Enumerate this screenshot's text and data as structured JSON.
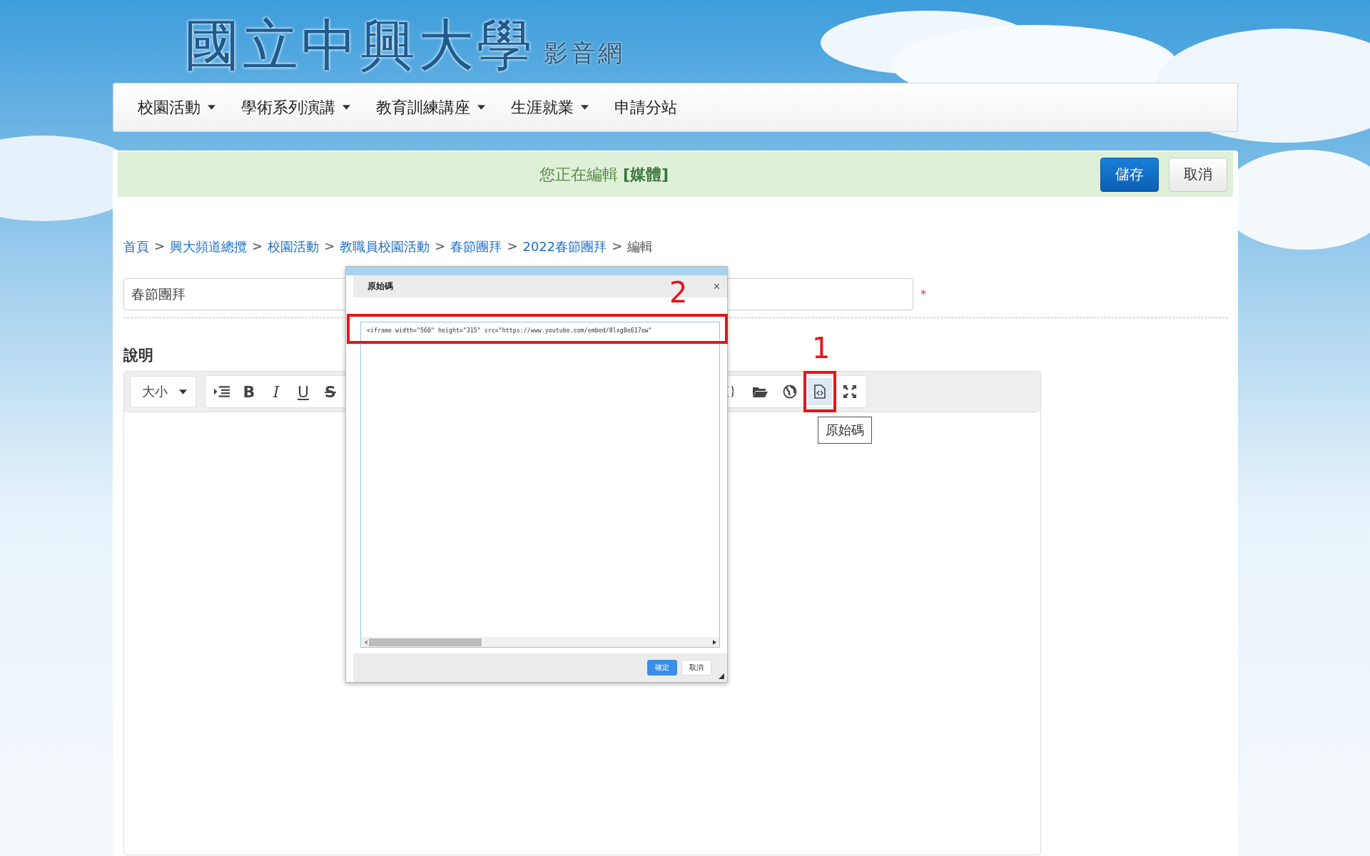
{
  "header": {
    "title": "國立中興大學",
    "subtitle": "影音網"
  },
  "nav": [
    {
      "label": "校園活動",
      "dropdown": true
    },
    {
      "label": "學術系列演講",
      "dropdown": true
    },
    {
      "label": "教育訓練講座",
      "dropdown": true
    },
    {
      "label": "生涯就業",
      "dropdown": true
    },
    {
      "label": "申請分站",
      "dropdown": false
    }
  ],
  "edit_banner": {
    "text": "您正在編輯 **[媒體]**",
    "buttons": [
      {
        "label": "儲存",
        "kind": "primary"
      },
      {
        "label": "取消",
        "kind": "default"
      }
    ]
  },
  "breadcrumb": {
    "separator": ">",
    "links": [
      "首頁",
      "興大頻道總攬",
      "校園活動",
      "教職員校園活動",
      "春節團拜",
      "2022春節團拜"
    ],
    "current": "編輯"
  },
  "title_field": {
    "value": "春節團拜",
    "required_mark": "*"
  },
  "description": {
    "label": "說明"
  },
  "toolbar": {
    "size_dropdown": "大小",
    "left_tools": [
      {
        "kind": "indent",
        "selected": false
      },
      {
        "kind": "bold",
        "glyph": "B",
        "selected": false
      },
      {
        "kind": "italic",
        "glyph": "I",
        "selected": false
      },
      {
        "kind": "underline",
        "glyph": "U",
        "selected": false
      },
      {
        "kind": "strike",
        "glyph": "S",
        "selected": false
      }
    ],
    "right_tools": [
      {
        "kind": "brace",
        "selected": false
      },
      {
        "kind": "folder",
        "selected": false
      },
      {
        "kind": "globe",
        "selected": false
      },
      {
        "kind": "source",
        "selected": true
      },
      {
        "kind": "fullscreen",
        "selected": false
      }
    ],
    "tooltip": "原始碼"
  },
  "dialog": {
    "title": "原始碼",
    "close": "×",
    "code": "<iframe width=\"560\" height=\"315\" src=\"https://www.youtube.com/embed/8lxg8e617ow\"",
    "buttons": [
      {
        "label": "確定",
        "kind": "primary"
      },
      {
        "label": "取消",
        "kind": "default"
      }
    ]
  },
  "annotations": [
    {
      "label": "1"
    },
    {
      "label": "2"
    }
  ]
}
